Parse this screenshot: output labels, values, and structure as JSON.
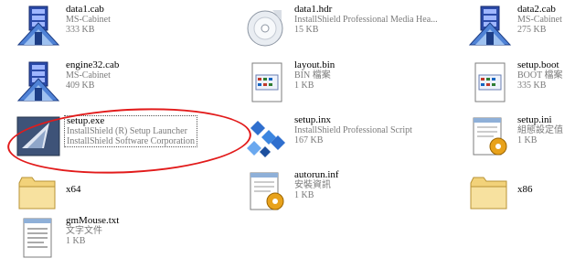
{
  "colors": {
    "highlight": "#e21b1b",
    "subtext": "#7a7a7a"
  },
  "files": [
    {
      "name": "data1.cab",
      "type": "MS-Cabinet",
      "detail": "333 KB",
      "icon": "cabinet-icon"
    },
    {
      "name": "data1.hdr",
      "type": "InstallShield Professional Media Hea...",
      "detail": "15 KB",
      "icon": "cd-icon"
    },
    {
      "name": "data2.cab",
      "type": "MS-Cabinet",
      "detail": "275 KB",
      "icon": "cabinet-icon"
    },
    {
      "name": "engine32.cab",
      "type": "MS-Cabinet",
      "detail": "409 KB",
      "icon": "cabinet-icon"
    },
    {
      "name": "layout.bin",
      "type": "BIN 檔案",
      "detail": "1 KB",
      "icon": "bin-icon"
    },
    {
      "name": "setup.boot",
      "type": "BOOT 檔案",
      "detail": "335 KB",
      "icon": "bin-icon"
    },
    {
      "name": "setup.exe",
      "type": "InstallShield (R) Setup Launcher",
      "detail": "InstallShield Software Corporation",
      "icon": "setup-exe-icon"
    },
    {
      "name": "setup.inx",
      "type": "InstallShield Professional Script",
      "detail": "167 KB",
      "icon": "script-icon"
    },
    {
      "name": "setup.ini",
      "type": "組態設定值",
      "detail": "1 KB",
      "icon": "config-icon"
    },
    {
      "name": "x64",
      "type": "",
      "detail": "",
      "icon": "folder-icon"
    },
    {
      "name": "autorun.inf",
      "type": "安裝資訊",
      "detail": "1 KB",
      "icon": "config-icon"
    },
    {
      "name": "x86",
      "type": "",
      "detail": "",
      "icon": "folder-icon"
    },
    {
      "name": "gmMouse.txt",
      "type": "文字文件",
      "detail": "1 KB",
      "icon": "text-file-icon"
    }
  ]
}
